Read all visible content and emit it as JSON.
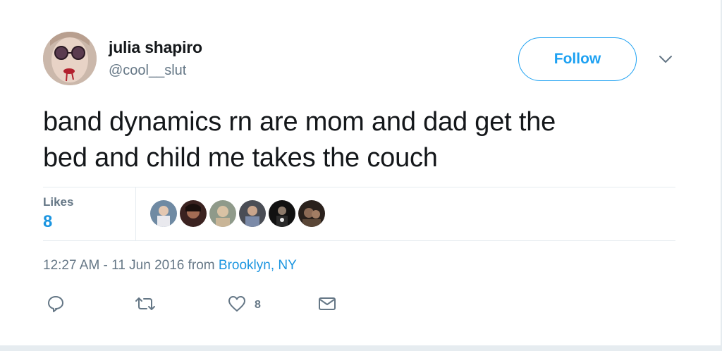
{
  "user": {
    "name": "julia shapiro",
    "handle": "@cool__slut"
  },
  "header": {
    "follow_label": "Follow"
  },
  "tweet": {
    "line1": "band dynamics rn are mom and dad get the",
    "line2": "bed and child me takes the couch"
  },
  "stats": {
    "likes_label": "Likes",
    "likes_count": "8",
    "liker_avatars": [
      "liker-1",
      "liker-2",
      "liker-3",
      "liker-4",
      "liker-5",
      "liker-6"
    ]
  },
  "meta": {
    "timestamp": "12:27 AM - 11 Jun 2016 from ",
    "location": "Brooklyn, NY"
  },
  "actions": {
    "reply_icon": "reply-icon",
    "retweet_icon": "retweet-icon",
    "like_icon": "heart-icon",
    "like_count": "8",
    "dm_icon": "envelope-icon"
  },
  "colors": {
    "accent": "#1da1f2",
    "link": "#1b95e0",
    "muted": "#657786",
    "text": "#14171a",
    "border": "#e6ecf0"
  }
}
